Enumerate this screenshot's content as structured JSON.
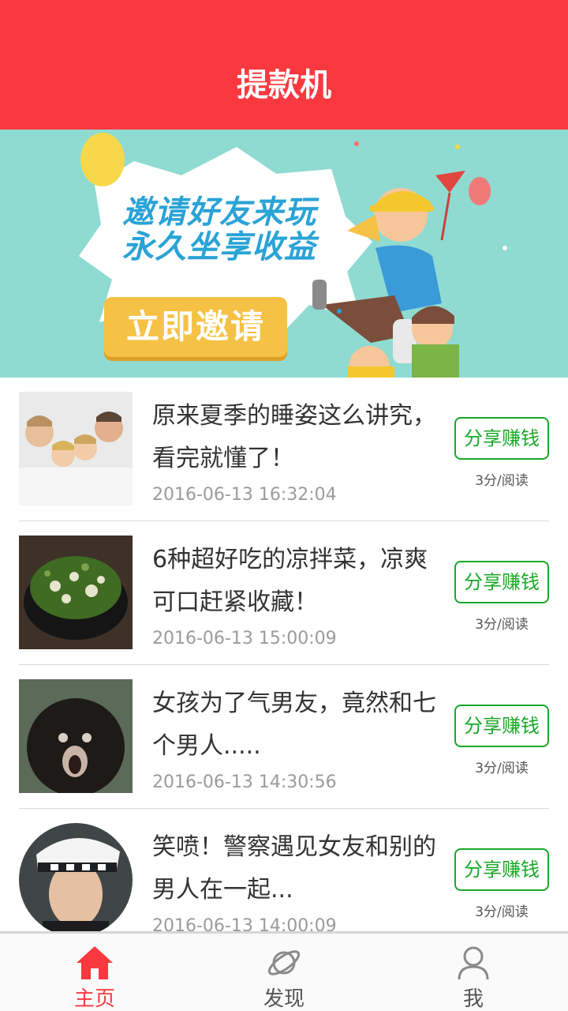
{
  "header": {
    "title": "提款机"
  },
  "banner": {
    "line1": "邀请好友来玩",
    "line2": "永久坐享收益",
    "button_label": "立即邀请"
  },
  "articles": [
    {
      "title": "原来夏季的睡姿这么讲究，看完就懂了！",
      "date": "2016-06-13 16:32:04",
      "share_label": "分享赚钱",
      "reward": "3分/阅读"
    },
    {
      "title": "6种超好吃的凉拌菜，凉爽可口赶紧收藏！",
      "date": "2016-06-13 15:00:09",
      "share_label": "分享赚钱",
      "reward": "3分/阅读"
    },
    {
      "title": "女孩为了气男友，竟然和七个男人.....",
      "date": "2016-06-13 14:30:56",
      "share_label": "分享赚钱",
      "reward": "3分/阅读"
    },
    {
      "title": "笑喷！警察遇见女友和别的男人在一起...",
      "date": "2016-06-13 14:00:09",
      "share_label": "分享赚钱",
      "reward": "3分/阅读"
    }
  ],
  "tabs": [
    {
      "label": "主页",
      "icon": "home-icon",
      "active": true
    },
    {
      "label": "发现",
      "icon": "planet-icon",
      "active": false
    },
    {
      "label": "我",
      "icon": "person-icon",
      "active": false
    }
  ],
  "colors": {
    "primary": "#f9393f",
    "share_green": "#19a827",
    "banner_bg": "#8fdbd2"
  }
}
